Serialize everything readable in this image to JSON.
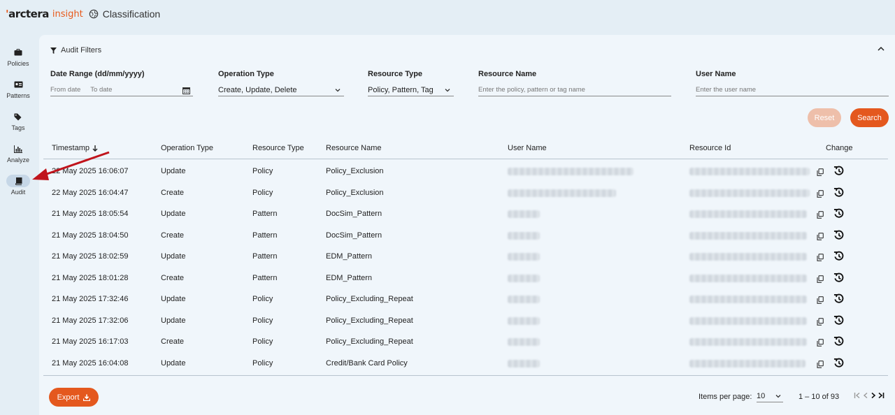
{
  "app": {
    "brand": "arctera",
    "brand_sub": "insight",
    "title": "Classification",
    "accent": "#e4581e"
  },
  "sidebar": {
    "items": [
      {
        "label": "Policies",
        "icon": "briefcase-icon"
      },
      {
        "label": "Patterns",
        "icon": "id-card-icon"
      },
      {
        "label": "Tags",
        "icon": "tags-icon"
      },
      {
        "label": "Analyze",
        "icon": "bar-chart-icon"
      },
      {
        "label": "Audit",
        "icon": "book-icon",
        "active": true
      }
    ]
  },
  "filters": {
    "title": "Audit Filters",
    "date_range": {
      "label": "Date Range (dd/mm/yyyy)",
      "from_placeholder": "From date",
      "to_placeholder": "To date"
    },
    "operation_type": {
      "label": "Operation Type",
      "value": "Create, Update, Delete"
    },
    "resource_type": {
      "label": "Resource Type",
      "value": "Policy, Pattern, Tag"
    },
    "resource_name": {
      "label": "Resource Name",
      "placeholder": "Enter the policy, pattern or tag name"
    },
    "user_name": {
      "label": "User Name",
      "placeholder": "Enter the user name"
    },
    "reset_label": "Reset",
    "search_label": "Search"
  },
  "table": {
    "columns": [
      "Timestamp",
      "Operation Type",
      "Resource Type",
      "Resource Name",
      "User Name",
      "Resource Id",
      "Change"
    ],
    "rows": [
      {
        "timestamp": "22 May 2025 16:06:07",
        "operation": "Update",
        "resource_type": "Policy",
        "resource_name": "Policy_Exclusion"
      },
      {
        "timestamp": "22 May 2025 16:04:47",
        "operation": "Create",
        "resource_type": "Policy",
        "resource_name": "Policy_Exclusion"
      },
      {
        "timestamp": "21 May 2025 18:05:54",
        "operation": "Update",
        "resource_type": "Pattern",
        "resource_name": "DocSim_Pattern"
      },
      {
        "timestamp": "21 May 2025 18:04:50",
        "operation": "Create",
        "resource_type": "Pattern",
        "resource_name": "DocSim_Pattern"
      },
      {
        "timestamp": "21 May 2025 18:02:59",
        "operation": "Update",
        "resource_type": "Pattern",
        "resource_name": "EDM_Pattern"
      },
      {
        "timestamp": "21 May 2025 18:01:28",
        "operation": "Create",
        "resource_type": "Pattern",
        "resource_name": "EDM_Pattern"
      },
      {
        "timestamp": "21 May 2025 17:32:46",
        "operation": "Update",
        "resource_type": "Policy",
        "resource_name": "Policy_Excluding_Repeat"
      },
      {
        "timestamp": "21 May 2025 17:32:06",
        "operation": "Update",
        "resource_type": "Policy",
        "resource_name": "Policy_Excluding_Repeat"
      },
      {
        "timestamp": "21 May 2025 16:17:03",
        "operation": "Create",
        "resource_type": "Policy",
        "resource_name": "Policy_Excluding_Repeat"
      },
      {
        "timestamp": "21 May 2025 16:04:08",
        "operation": "Update",
        "resource_type": "Policy",
        "resource_name": "Credit/Bank Card Policy"
      }
    ]
  },
  "footer": {
    "export_label": "Export",
    "items_per_page_label": "Items per page:",
    "items_per_page_value": "10",
    "range_text": "1 – 10 of 93"
  }
}
